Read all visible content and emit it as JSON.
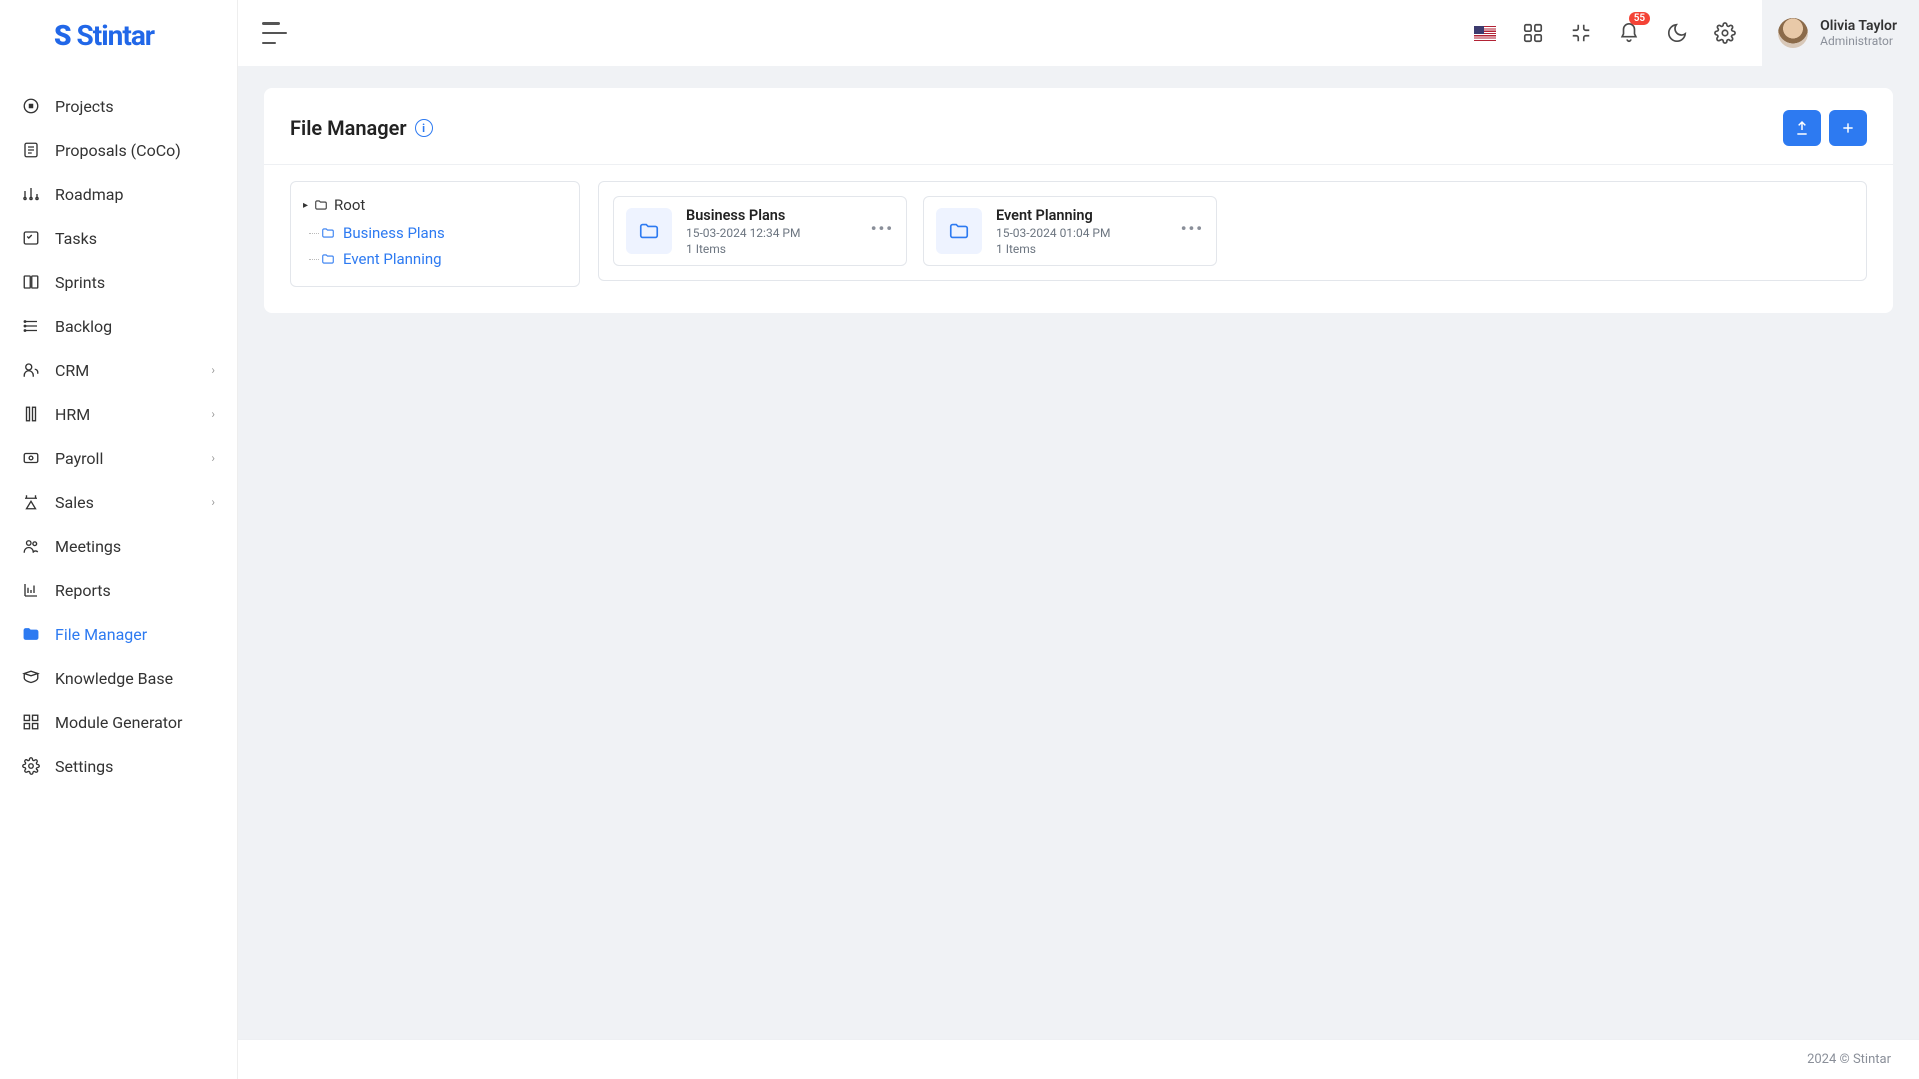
{
  "brand": "Stintar",
  "sidebar": {
    "items": [
      {
        "label": "Projects",
        "icon": "project",
        "chevron": false,
        "active": false
      },
      {
        "label": "Proposals (CoCo)",
        "icon": "proposal",
        "chevron": false,
        "active": false
      },
      {
        "label": "Roadmap",
        "icon": "roadmap",
        "chevron": false,
        "active": false
      },
      {
        "label": "Tasks",
        "icon": "tasks",
        "chevron": false,
        "active": false
      },
      {
        "label": "Sprints",
        "icon": "sprints",
        "chevron": false,
        "active": false
      },
      {
        "label": "Backlog",
        "icon": "backlog",
        "chevron": false,
        "active": false
      },
      {
        "label": "CRM",
        "icon": "crm",
        "chevron": true,
        "active": false
      },
      {
        "label": "HRM",
        "icon": "hrm",
        "chevron": true,
        "active": false
      },
      {
        "label": "Payroll",
        "icon": "payroll",
        "chevron": true,
        "active": false
      },
      {
        "label": "Sales",
        "icon": "sales",
        "chevron": true,
        "active": false
      },
      {
        "label": "Meetings",
        "icon": "meetings",
        "chevron": false,
        "active": false
      },
      {
        "label": "Reports",
        "icon": "reports",
        "chevron": false,
        "active": false
      },
      {
        "label": "File Manager",
        "icon": "filemanager",
        "chevron": false,
        "active": true
      },
      {
        "label": "Knowledge Base",
        "icon": "knowledge",
        "chevron": false,
        "active": false
      },
      {
        "label": "Module Generator",
        "icon": "module",
        "chevron": false,
        "active": false
      },
      {
        "label": "Settings",
        "icon": "settings",
        "chevron": false,
        "active": false
      }
    ]
  },
  "topbar": {
    "notification_count": "55",
    "user_name": "Olivia Taylor",
    "user_role": "Administrator"
  },
  "page": {
    "title": "File Manager",
    "tree": {
      "root_label": "Root",
      "children": [
        {
          "label": "Business Plans"
        },
        {
          "label": "Event Planning"
        }
      ]
    },
    "folders": [
      {
        "name": "Business Plans",
        "date": "15-03-2024 12:34 PM",
        "items": "1 Items"
      },
      {
        "name": "Event Planning",
        "date": "15-03-2024 01:04 PM",
        "items": "1 Items"
      }
    ]
  },
  "footer": "2024 © Stintar"
}
